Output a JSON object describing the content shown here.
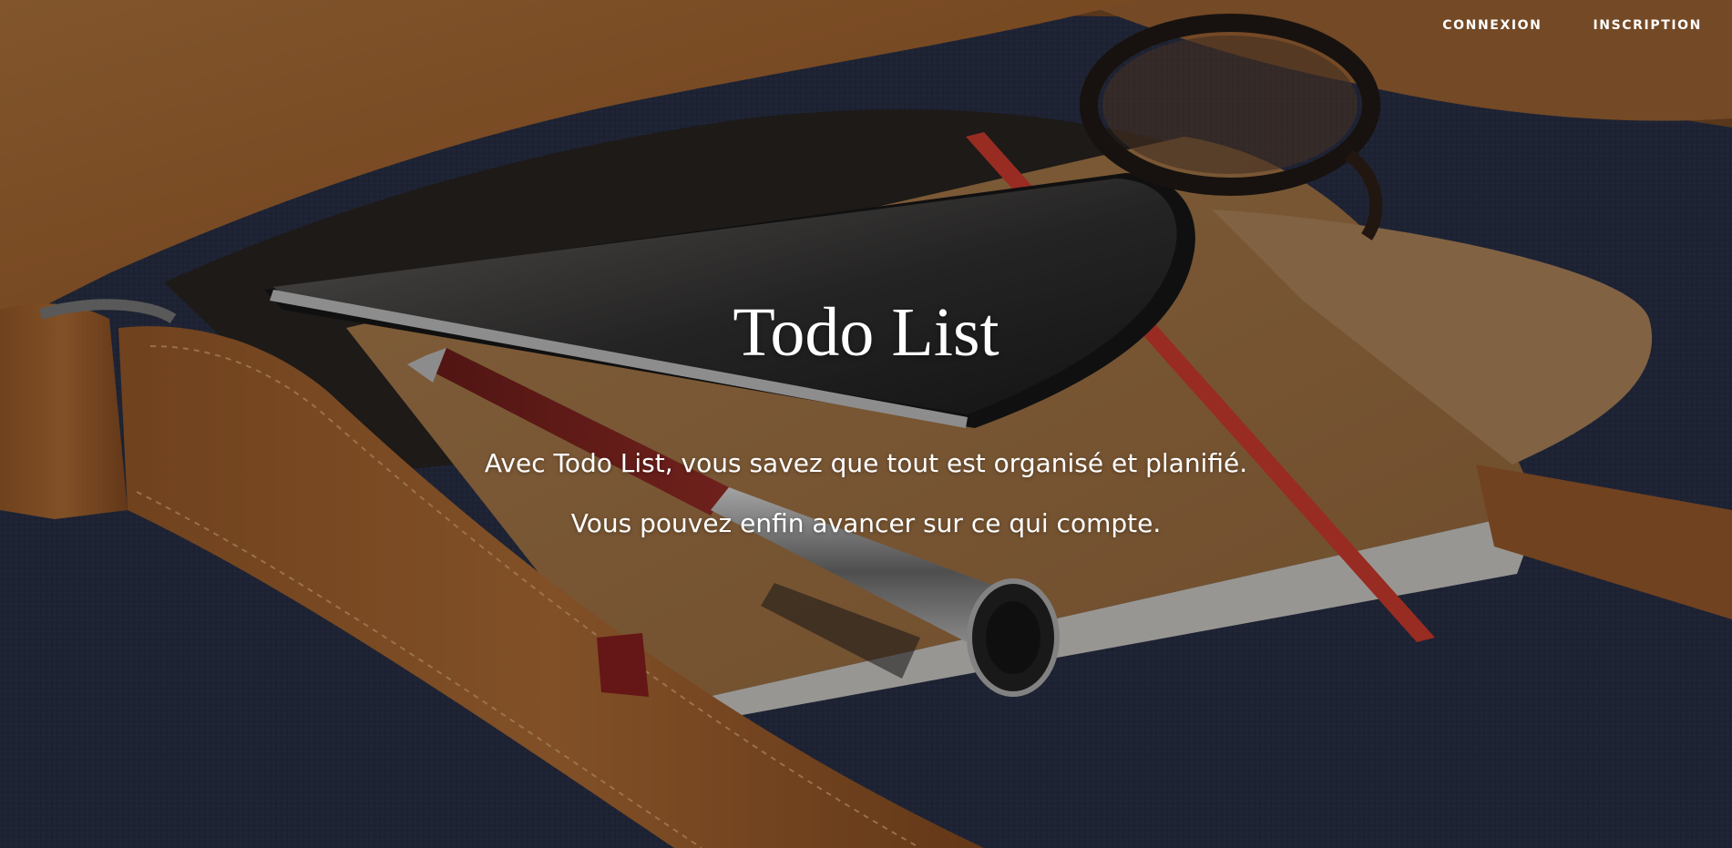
{
  "nav": {
    "login_label": "CONNEXION",
    "signup_label": "INSCRIPTION"
  },
  "hero": {
    "title": "Todo List",
    "tagline_1": "Avec Todo List, vous savez que tout est organisé et planifié.",
    "tagline_2": "Vous pouvez enfin avancer sur ce qui compte."
  },
  "colors": {
    "text": "#ffffff",
    "leather": "#a8652c",
    "fabric": "#1f2a44",
    "strap_red": "#d83a2c"
  }
}
